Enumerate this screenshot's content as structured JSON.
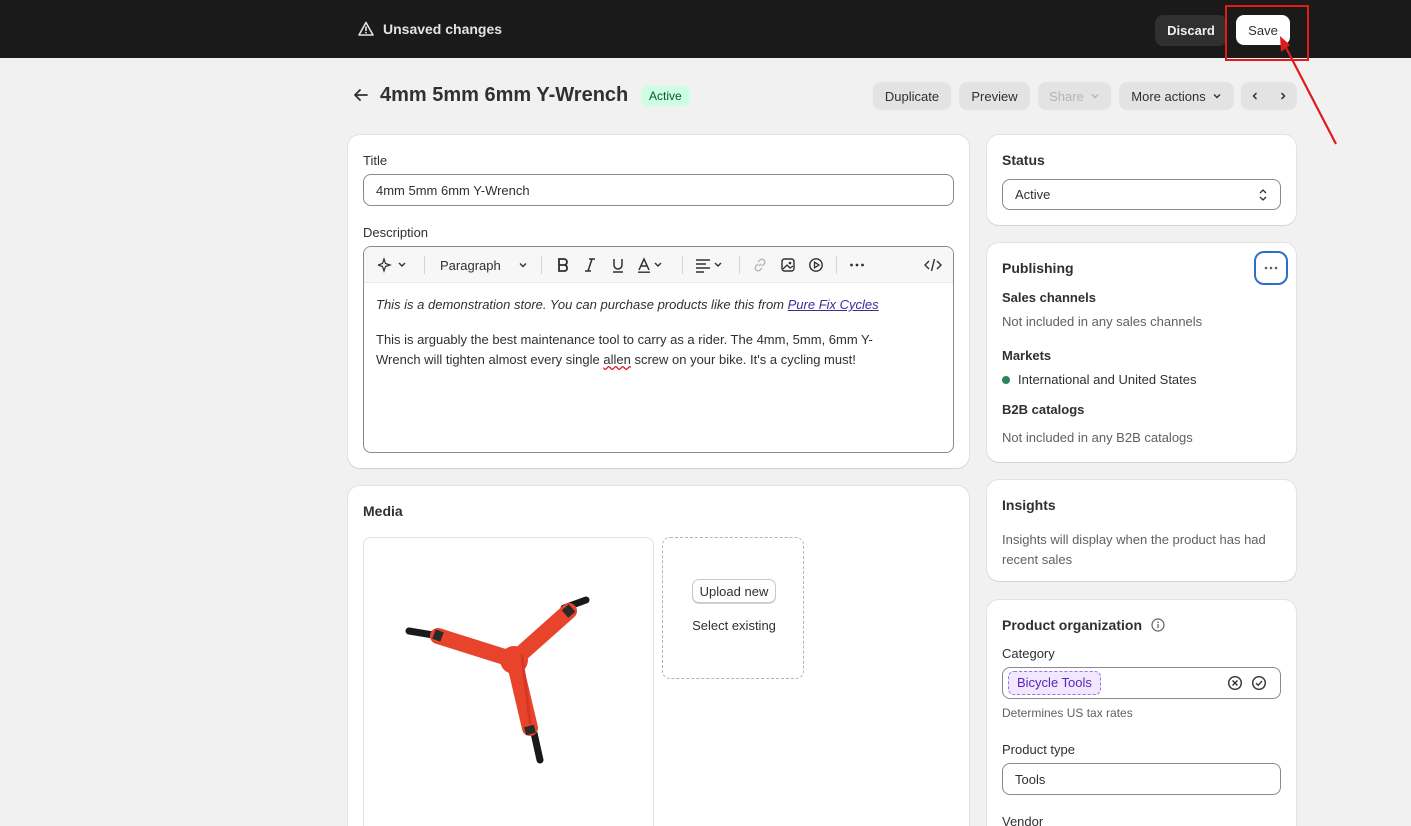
{
  "topbar": {
    "unsaved_label": "Unsaved changes",
    "discard_label": "Discard",
    "save_label": "Save"
  },
  "header": {
    "title": "4mm 5mm 6mm Y-Wrench",
    "status_badge": "Active",
    "duplicate_label": "Duplicate",
    "preview_label": "Preview",
    "share_label": "Share",
    "more_actions_label": "More actions"
  },
  "product": {
    "title_label": "Title",
    "title_value": "4mm 5mm 6mm Y-Wrench",
    "description_label": "Description",
    "toolbar": {
      "paragraph_label": "Paragraph"
    },
    "description": {
      "line1_text": "This is a demonstration store. You can purchase products like this from ",
      "line1_link": "Pure Fix Cycles",
      "para2_before": "This is arguably the best maintenance tool to carry as a rider. The 4mm, 5mm, 6mm Y-Wrench will tighten almost every single ",
      "para2_misspelled": "allen",
      "para2_after": " screw on your bike. It's a cycling must!"
    }
  },
  "media": {
    "heading": "Media",
    "upload_label": "Upload new",
    "select_existing_label": "Select existing"
  },
  "status_card": {
    "heading": "Status",
    "value": "Active"
  },
  "publishing": {
    "heading": "Publishing",
    "sales_channels_label": "Sales channels",
    "sales_channels_value": "Not included in any sales channels",
    "markets_label": "Markets",
    "markets_value": "International and United States",
    "b2b_label": "B2B catalogs",
    "b2b_value": "Not included in any B2B catalogs"
  },
  "insights": {
    "heading": "Insights",
    "text": "Insights will display when the product has had recent sales"
  },
  "organization": {
    "heading": "Product organization",
    "category_label": "Category",
    "category_value": "Bicycle Tools",
    "category_help": "Determines US tax rates",
    "type_label": "Product type",
    "type_value": "Tools",
    "vendor_label": "Vendor"
  },
  "colors": {
    "topbar_bg": "#1a1a1a",
    "page_bg": "#f1f1f1",
    "active_badge_bg": "#cdfee1",
    "annotation_red": "#e01b1b",
    "wrench_red": "#e8442c"
  }
}
